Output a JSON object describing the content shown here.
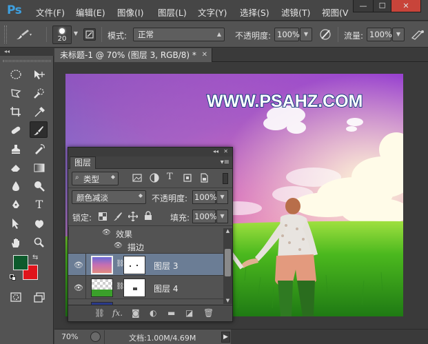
{
  "app": {
    "logo": "Ps"
  },
  "menu": [
    "文件(F)",
    "编辑(E)",
    "图像(I)",
    "图层(L)",
    "文字(Y)",
    "选择(S)",
    "滤镜(T)",
    "视图(V"
  ],
  "window_controls": {
    "minimize": "—",
    "maximize": "☐",
    "close": "✕"
  },
  "options": {
    "brush_size": "20",
    "mode_label": "模式:",
    "mode_value": "正常",
    "opacity_label": "不透明度:",
    "opacity_value": "100%",
    "flow_label": "流量:",
    "flow_value": "100%"
  },
  "colors": {
    "foreground": "#0d5a2c",
    "background": "#e0141c",
    "accent_selection": "#6b7d95"
  },
  "document": {
    "tab_title": "未标题-1 @ 70% (图层 3, RGB/8) *",
    "tab_close": "✕",
    "watermark": "WWW.PSAHZ.COM"
  },
  "layers_panel": {
    "tab": "图层",
    "filter_kind": "类型",
    "blend_mode": "颜色减淡",
    "opacity_label": "不透明度:",
    "opacity_value": "100%",
    "lock_label": "锁定:",
    "fill_label": "填充:",
    "fill_value": "100%",
    "effects_label": "效果",
    "stroke_label": "描边",
    "layers": [
      {
        "name": "图层 3",
        "selected": true
      },
      {
        "name": "图层 4",
        "selected": false
      }
    ]
  },
  "status": {
    "zoom": "70%",
    "doc_info": "文档:1.00M/4.69M"
  }
}
